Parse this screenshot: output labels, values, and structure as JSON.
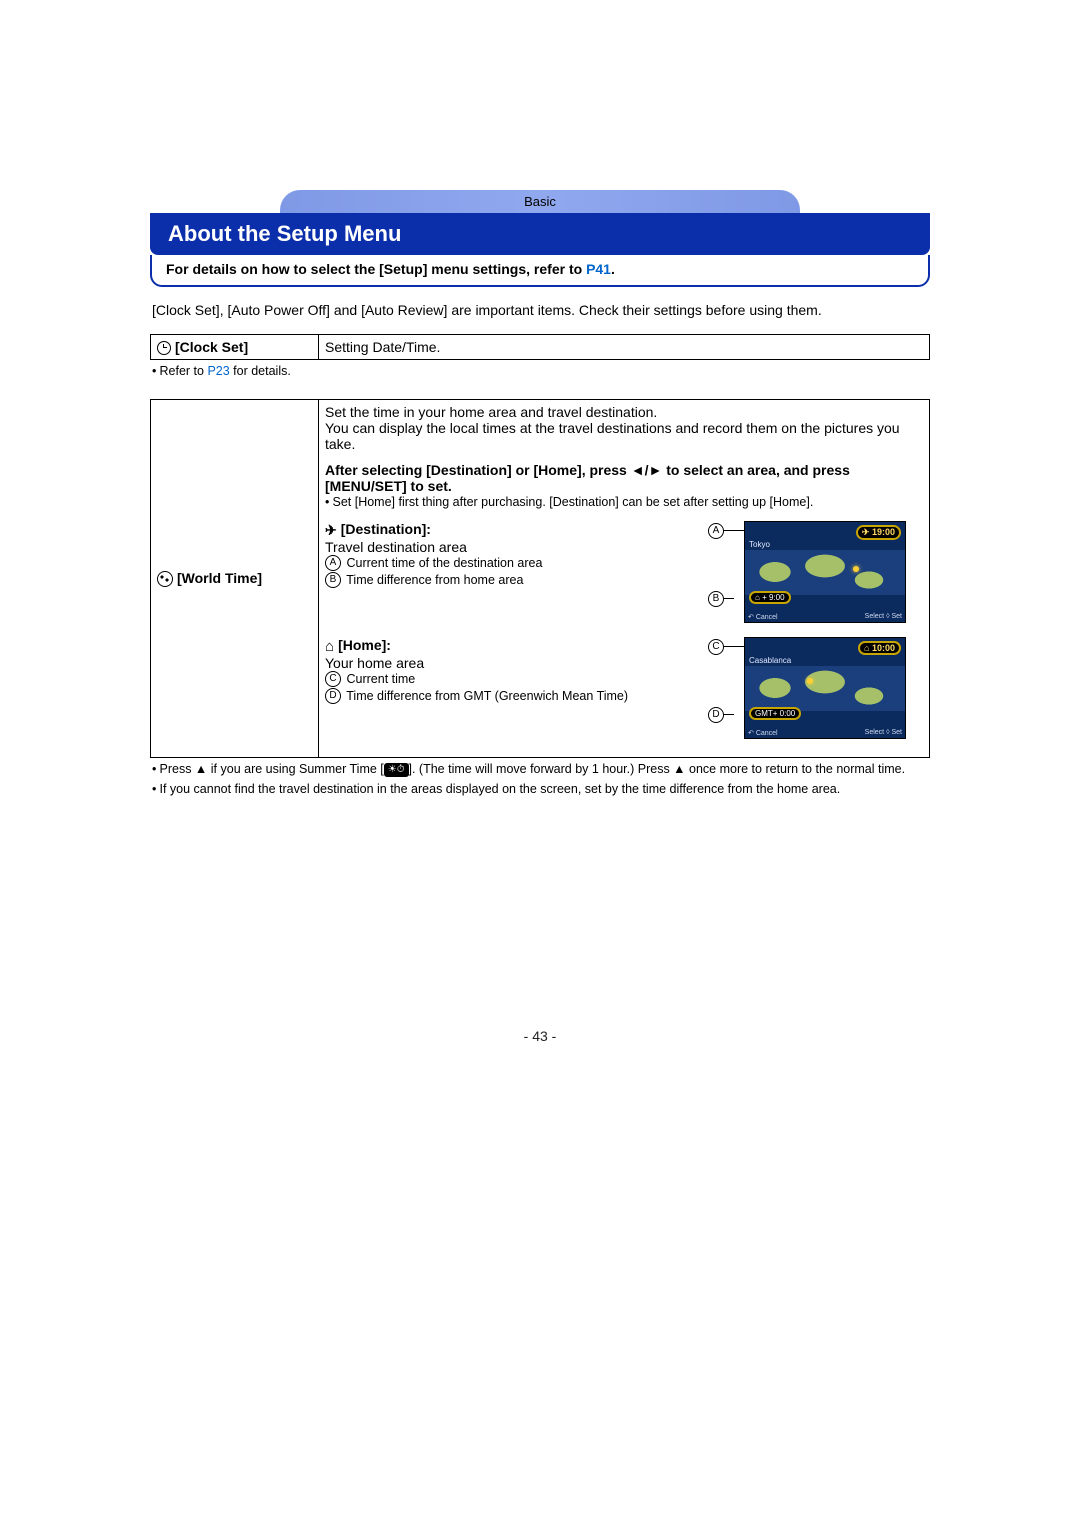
{
  "header": {
    "section": "Basic"
  },
  "title": "About the Setup Menu",
  "details": {
    "prefix": "For details on how to select the [Setup] menu settings, refer to ",
    "link": "P41",
    "suffix": "."
  },
  "intro": "[Clock Set], [Auto Power Off] and [Auto Review] are important items. Check their settings before using them.",
  "clockset": {
    "label": "[Clock Set]",
    "desc": "Setting Date/Time."
  },
  "refnote": {
    "prefix": "Refer to ",
    "link": "P23",
    "suffix": " for details."
  },
  "worldtime": {
    "label": "[World Time]",
    "line1": "Set the time in your home area and travel destination.",
    "line2": "You can display the local times at the travel destinations and record them on the pictures you take.",
    "bold1a": "After selecting [Destination] or [Home], press ",
    "bold1b": " to select an area, and press [MENU/SET] to set.",
    "sub1": "Set [Home] first thing after purchasing. [Destination] can be set after setting up [Home].",
    "dest_label": "[Destination]:",
    "dest_desc": "Travel destination area",
    "dest_a": "Current time of the destination area",
    "dest_b": "Time difference from home area",
    "home_label": "[Home]:",
    "home_desc": "Your home area",
    "home_c": "Current time",
    "home_d": "Time difference from GMT (Greenwich Mean Time)",
    "lcd_dest": {
      "time": "19:00",
      "city": "Tokyo",
      "diff": "+ 9:00",
      "cancel": "Cancel",
      "select": "Select",
      "set": "Set"
    },
    "lcd_home": {
      "time": "10:00",
      "city": "Casablanca",
      "diff": "GMT+ 0:00",
      "cancel": "Cancel",
      "select": "Select",
      "set": "Set"
    },
    "letters": {
      "a": "A",
      "b": "B",
      "c": "C",
      "d": "D"
    }
  },
  "notes": {
    "n1a": "Press ▲ if you are using Summer Time [",
    "n1_icon": "☀⏱",
    "n1b": "]. (The time will move forward by 1 hour.) Press ▲ once more to return to the normal time.",
    "n2": "If you cannot find the travel destination in the areas displayed on the screen, set by the time difference from the home area."
  },
  "page_no": "- 43 -"
}
